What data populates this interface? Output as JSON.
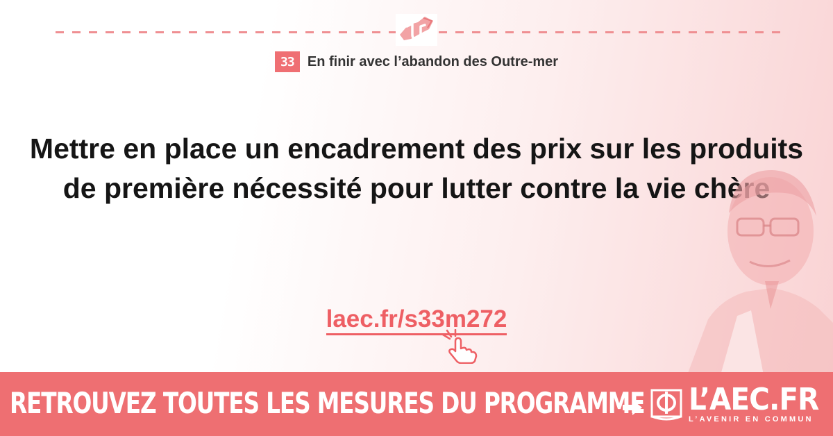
{
  "chapter": {
    "number": "33",
    "title": "En finir avec l’abandon des Outre-mer"
  },
  "measure": {
    "headline": "Mettre en place un encadrement des prix sur les produits de première nécessité pour lutter contre la vie chère"
  },
  "link": {
    "text": "laec.fr/s33m272"
  },
  "banner": {
    "cta": "RETROUVEZ TOUTES LES MESURES DU PROGRAMME",
    "logo_text": "L’AEC.FR",
    "tagline": "L’AVENIR EN COMMUN"
  },
  "colors": {
    "accent": "#ee6f72",
    "link": "#ee5f64",
    "text": "#151515"
  },
  "icons": {
    "top": "handshake-icon",
    "pointer": "hand-pointer-icon",
    "arrow": "arrow-right-icon",
    "logo": "phi-book-logo"
  }
}
